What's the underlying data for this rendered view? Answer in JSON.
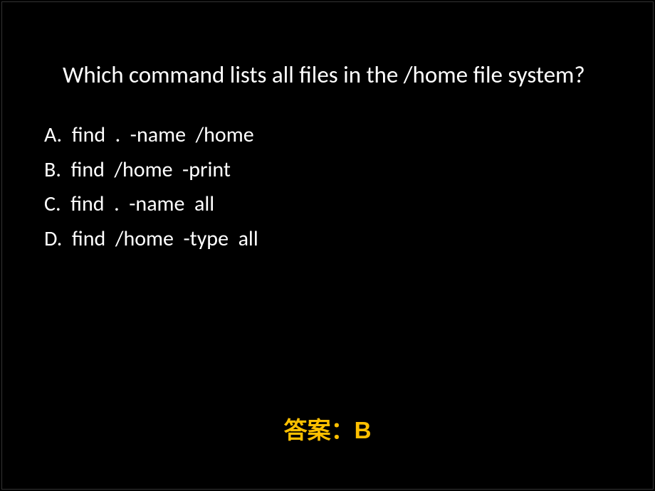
{
  "question": "Which command lists all files in the /home file system?",
  "options": [
    {
      "letter": "A",
      "text": "find  .  -name  /home"
    },
    {
      "letter": "B",
      "text": "find  /home  -print"
    },
    {
      "letter": "C",
      "text": "find  .  -name  all"
    },
    {
      "letter": "D",
      "text": "find  /home  -type  all"
    }
  ],
  "answer_label": "答案：",
  "answer_value": "B",
  "colors": {
    "background": "#000000",
    "text": "#ffffff",
    "answer": "#ffc000"
  }
}
